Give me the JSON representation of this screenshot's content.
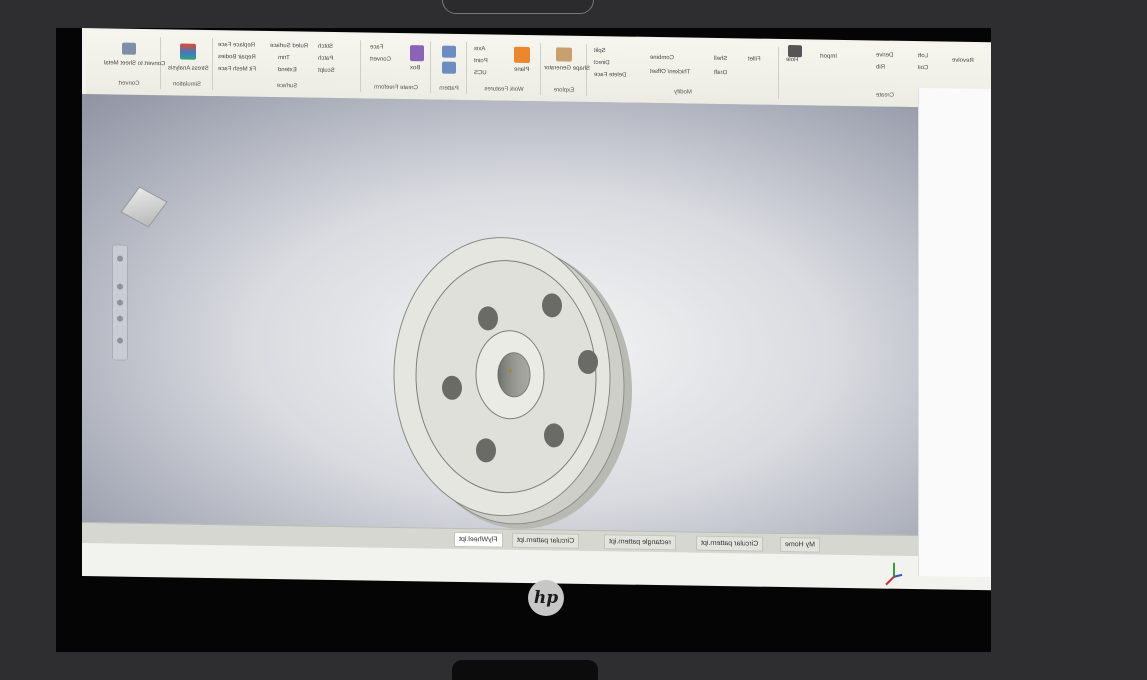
{
  "ribbon": {
    "groups": [
      {
        "label": "Convert"
      },
      {
        "label": "Simulation"
      },
      {
        "label": "Surface"
      },
      {
        "label": "Create Freeform"
      },
      {
        "label": "Pattern"
      },
      {
        "label": "Work Features"
      },
      {
        "label": "Explore"
      },
      {
        "label": "Modify"
      },
      {
        "label": "Create"
      }
    ],
    "commands": {
      "convert_sheet_metal": "Convert to Sheet Metal",
      "stress_analysis": "Stress Analysis",
      "replace_face": "Replace Face",
      "repair_bodies": "Repair Bodies",
      "fit_mesh_face": "Fit Mesh Face",
      "ruled_surface": "Ruled Surface",
      "trim": "Trim",
      "extend": "Extend",
      "stitch": "Stitch",
      "patch": "Patch",
      "sculpt": "Sculpt",
      "face": "Face",
      "convert": "Convert",
      "box": "Box",
      "axis": "Axis",
      "point": "Point",
      "ucs": "UCS",
      "plane": "Plane",
      "shape_generator": "Shape Generator",
      "split": "Split",
      "direct": "Direct",
      "delete_face": "Delete Face",
      "combine": "Combine",
      "thicken_offset": "Thicken/ Offset",
      "shell": "Shell",
      "draft": "Draft",
      "hole": "Hole",
      "fillet": "Fillet",
      "import": "Import",
      "derive": "Derive",
      "rib": "Rib",
      "loft": "Loft",
      "coil": "Coil",
      "revolve": "Revolve"
    }
  },
  "tabs": [
    {
      "label": "My Home",
      "active": false
    },
    {
      "label": "Circular pattern.ipt",
      "active": false
    },
    {
      "label": "rectangle pattern.ipt",
      "active": false
    },
    {
      "label": "Circular pattern.ipt",
      "active": false
    },
    {
      "label": "FlyWheel.ipt",
      "active": true
    }
  ],
  "brand": {
    "logo_text": "hp",
    "logo_color": "#c7c7c7"
  },
  "colors": {
    "part": "#e6e6e1",
    "viewport_bg": "#a8acb8",
    "ribbon_bg": "#f3f3ec"
  }
}
